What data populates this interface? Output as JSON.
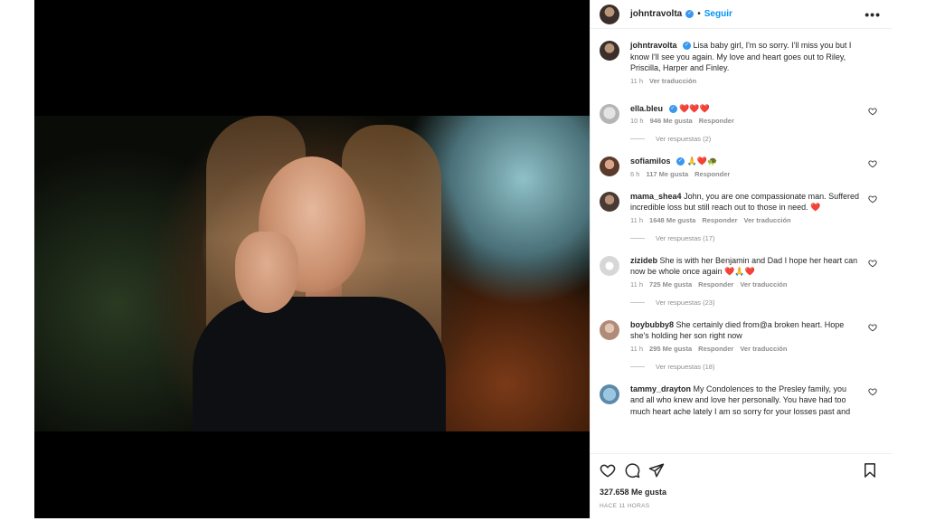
{
  "post": {
    "username": "johntravolta",
    "follow_label": "Seguir",
    "more_label": "•••",
    "separator": "•"
  },
  "caption": {
    "username": "johntravolta",
    "text": "Lisa baby girl, I'm so sorry. I'll miss you but I know I'll see you again. My love and heart goes out to Riley, Priscilla, Harper and Finley.",
    "time": "11 h",
    "translate": "Ver traducción"
  },
  "comments": [
    {
      "username": "ella.bleu",
      "verified": true,
      "text": "❤️❤️❤️",
      "time": "10 h",
      "likes": "946 Me gusta",
      "reply": "Responder",
      "translate": "",
      "replies": "Ver respuestas (2)"
    },
    {
      "username": "sofiamilos",
      "verified": true,
      "text": "🙏❤️🐢",
      "time": "6 h",
      "likes": "117 Me gusta",
      "reply": "Responder",
      "translate": "",
      "replies": ""
    },
    {
      "username": "mama_shea4",
      "verified": false,
      "text": "John, you are one compassionate man. Suffered incredible loss but still reach out to those in need. ❤️",
      "time": "11 h",
      "likes": "1648 Me gusta",
      "reply": "Responder",
      "translate": "Ver traducción",
      "replies": "Ver respuestas (17)"
    },
    {
      "username": "zizideb",
      "verified": false,
      "text": "She is with her Benjamin and Dad I hope her heart can now be whole once again ❤️🙏❤️",
      "time": "11 h",
      "likes": "725 Me gusta",
      "reply": "Responder",
      "translate": "Ver traducción",
      "replies": "Ver respuestas (23)"
    },
    {
      "username": "boybubby8",
      "verified": false,
      "text": "She certainly died from@a broken heart. Hope she's holding her son right now",
      "time": "11 h",
      "likes": "295 Me gusta",
      "reply": "Responder",
      "translate": "Ver traducción",
      "replies": "Ver respuestas (18)"
    },
    {
      "username": "tammy_drayton",
      "verified": false,
      "text": "My Condolences to the Presley family, you and all who knew and love her personally. You have had too much heart ache lately I am so sorry for your losses past and",
      "time": "",
      "likes": "",
      "reply": "",
      "translate": "",
      "replies": ""
    }
  ],
  "footer": {
    "likes": "327.658 Me gusta",
    "time": "HACE 11 HORAS"
  },
  "icons": {
    "like": "heart-icon",
    "comment": "comment-bubble-icon",
    "share": "paper-plane-icon",
    "save": "bookmark-icon",
    "verified": "verified-badge-icon",
    "comment_like": "heart-outline-icon"
  },
  "colors": {
    "accent": "#0095f6",
    "verified": "#3897f0",
    "secondary_text": "#8e8e8e",
    "media_bg": "#000000"
  }
}
